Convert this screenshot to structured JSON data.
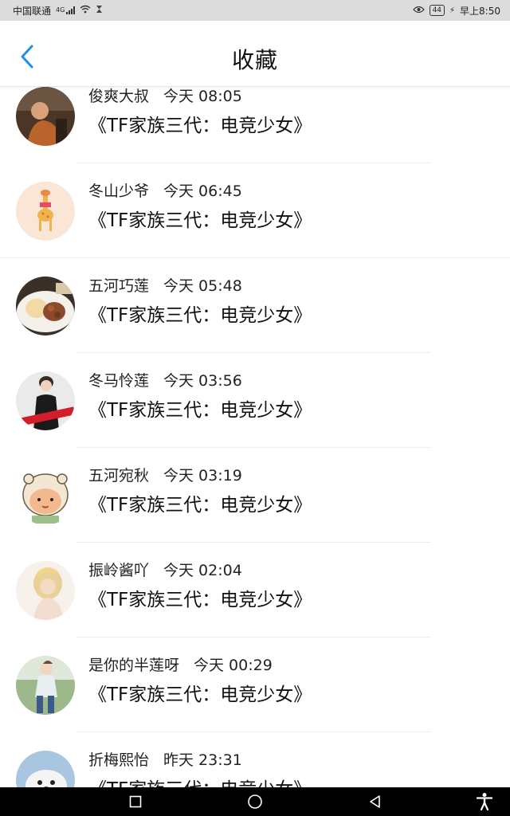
{
  "status_bar": {
    "carrier": "中国联通",
    "network": "4G",
    "battery": "44",
    "time": "早上8:50"
  },
  "header": {
    "title": "收藏"
  },
  "favorites": [
    {
      "name": "俊爽大叔",
      "time": "今天 08:05",
      "work": "《TF家族三代：电竞少女》"
    },
    {
      "name": "冬山少爷",
      "time": "今天 06:45",
      "work": "《TF家族三代：电竞少女》"
    },
    {
      "name": "五河巧莲",
      "time": "今天 05:48",
      "work": "《TF家族三代：电竞少女》"
    },
    {
      "name": "冬马怜莲",
      "time": "今天 03:56",
      "work": "《TF家族三代：电竞少女》"
    },
    {
      "name": "五河宛秋",
      "time": "今天 03:19",
      "work": "《TF家族三代：电竞少女》"
    },
    {
      "name": "振岭酱吖",
      "time": "今天 02:04",
      "work": "《TF家族三代：电竞少女》"
    },
    {
      "name": "是你的半莲呀",
      "time": "今天 00:29",
      "work": "《TF家族三代：电竞少女》"
    },
    {
      "name": "折梅熙怡",
      "time": "昨天 23:31",
      "work": "《TF家族三代：电竞少女》"
    }
  ],
  "colors": {
    "accent": "#1e90e8",
    "status_bar_bg": "#dcdcdc",
    "nav_bar_bg": "#000000"
  },
  "icons": {
    "back": "chevron-left-icon",
    "nav_recent": "square-icon",
    "nav_home": "circle-icon",
    "nav_back": "triangle-back-icon",
    "accessibility": "accessibility-icon"
  }
}
